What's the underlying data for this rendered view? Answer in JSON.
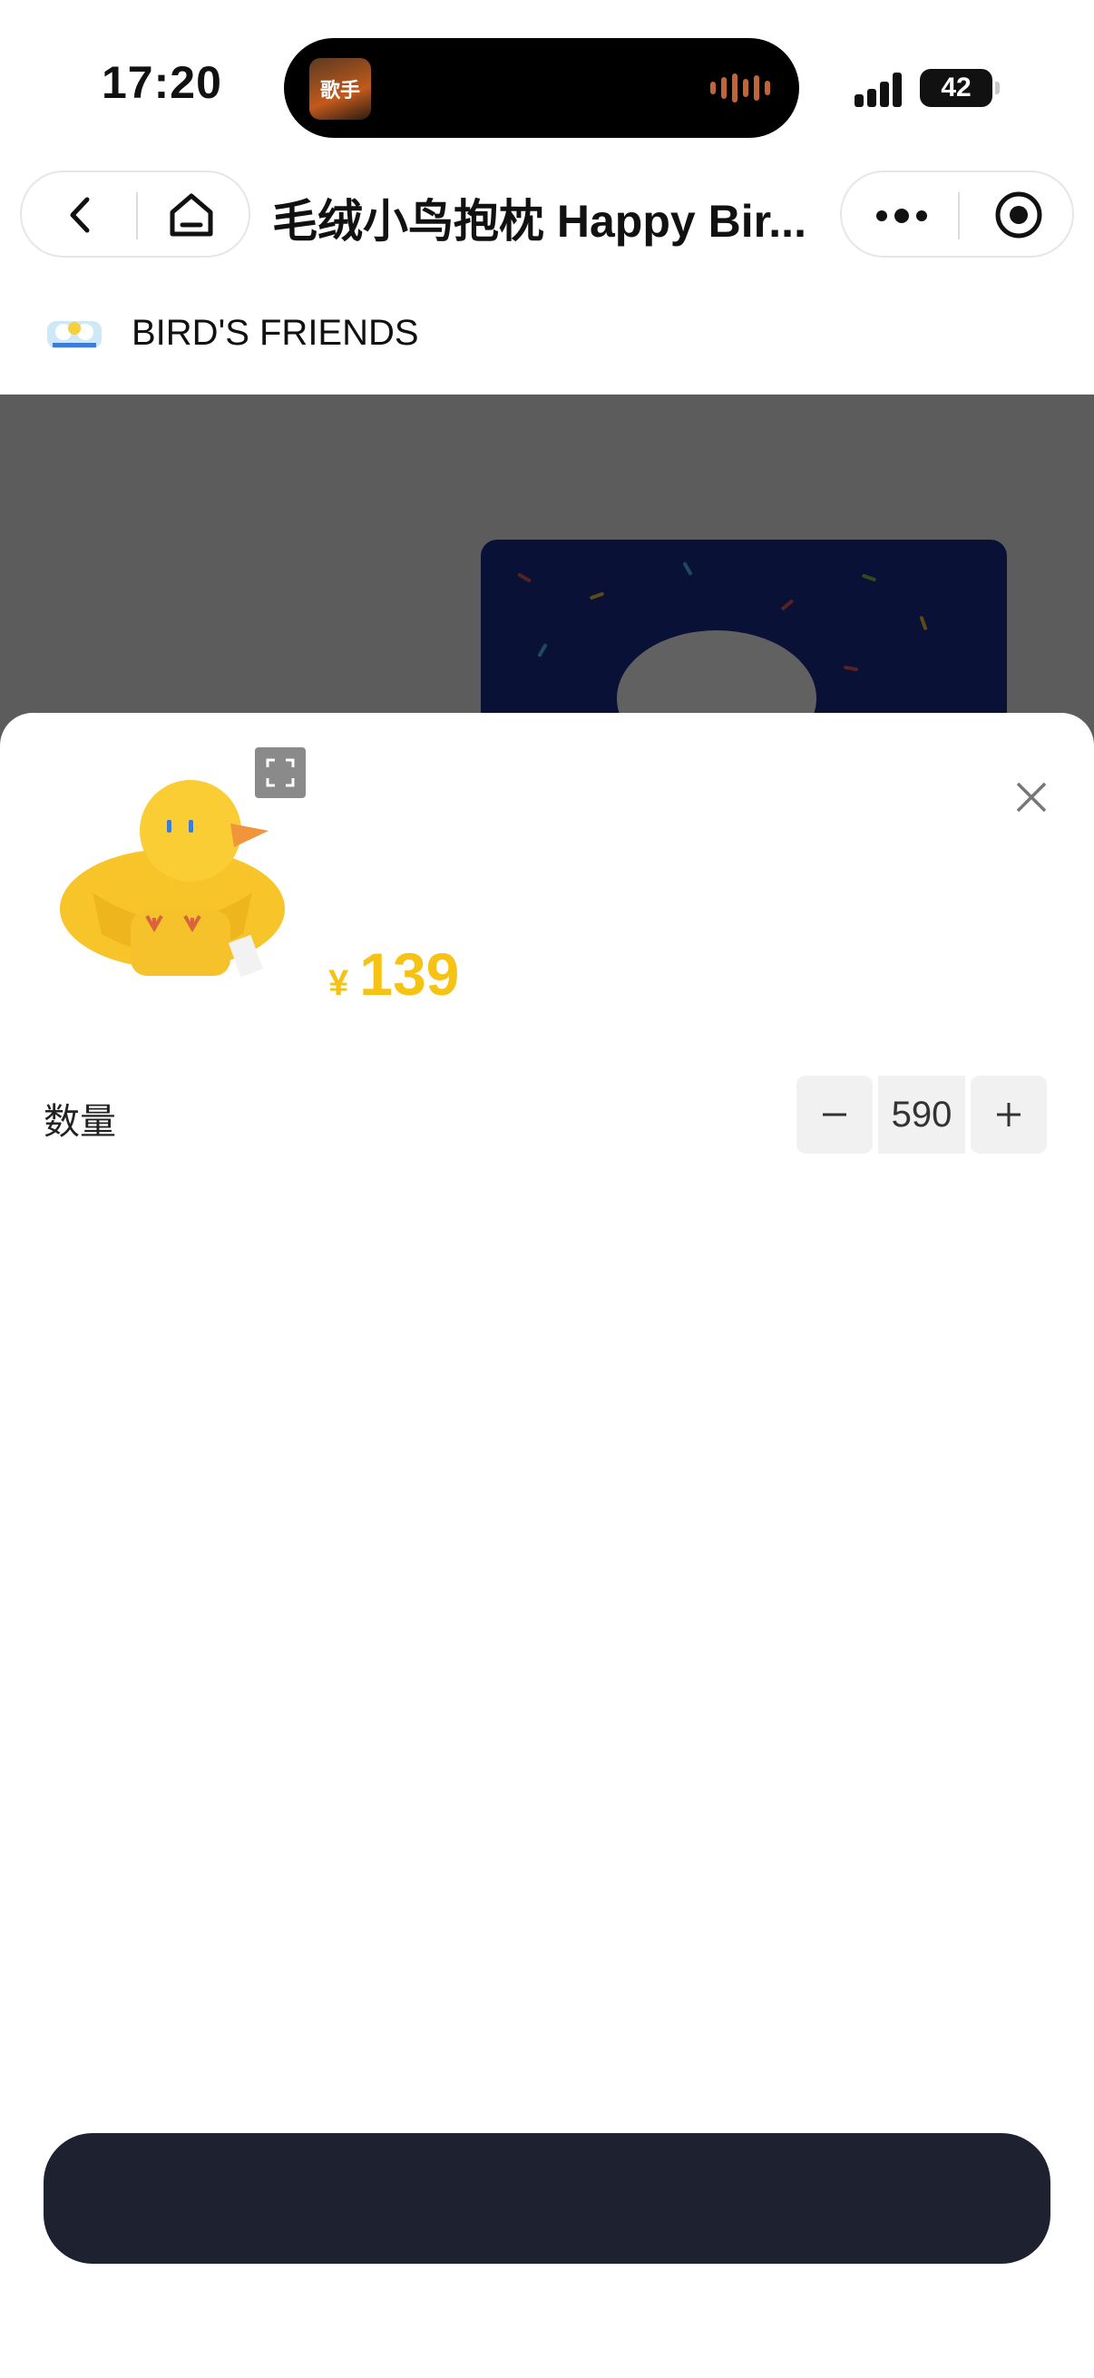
{
  "status_bar": {
    "time": "17:20",
    "battery": "42",
    "now_playing_art_text": "歌手"
  },
  "nav": {
    "title": "毛绒小鸟抱枕 Happy Bir..."
  },
  "store": {
    "name": "BIRD'S FRIENDS"
  },
  "sheet": {
    "price_symbol": "¥",
    "price_value": "139",
    "quantity_label": "数量",
    "quantity_value": "590",
    "confirm_label": ""
  },
  "colors": {
    "price": "#f6c314",
    "confirm_button": "#1e2230",
    "overlay": "rgba(0,0,0,0.62)"
  }
}
